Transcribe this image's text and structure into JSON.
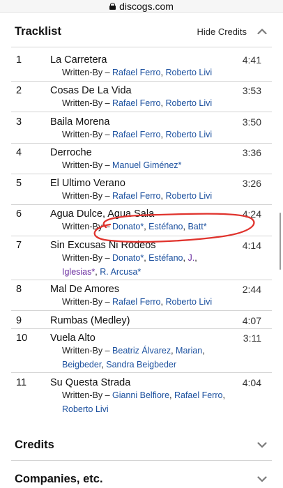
{
  "browser": {
    "domain": "discogs.com"
  },
  "tracklist": {
    "title": "Tracklist",
    "hide_credits_label": "Hide Credits",
    "tracks": [
      {
        "num": "1",
        "title": "La Carretera",
        "duration": "4:41",
        "role": "Written-By",
        "lines": [
          {
            "names": [
              "Rafael Ferro",
              "Roberto Livi"
            ]
          }
        ]
      },
      {
        "num": "2",
        "title": "Cosas De La Vida",
        "duration": "3:53",
        "role": "Written-By",
        "lines": [
          {
            "names": [
              "Rafael Ferro",
              "Roberto Livi"
            ]
          }
        ]
      },
      {
        "num": "3",
        "title": "Baila Morena",
        "duration": "3:50",
        "role": "Written-By",
        "lines": [
          {
            "names": [
              "Rafael Ferro",
              "Roberto Livi"
            ]
          }
        ]
      },
      {
        "num": "4",
        "title": "Derroche",
        "duration": "3:36",
        "role": "Written-By",
        "lines": [
          {
            "names": [
              "Manuel Giménez*"
            ]
          }
        ]
      },
      {
        "num": "5",
        "title": "El Ultimo Verano",
        "duration": "3:26",
        "role": "Written-By",
        "lines": [
          {
            "names": [
              "Rafael Ferro",
              "Roberto Livi"
            ]
          }
        ]
      },
      {
        "num": "6",
        "title": "Agua Dulce, Agua Sala",
        "duration": "4:24",
        "role": "Written-By",
        "lines": [
          {
            "names": [
              "Donato*",
              "Estéfano",
              "Batt*"
            ]
          }
        ]
      },
      {
        "num": "7",
        "title": "Sin Excusas Ni Rodeos",
        "duration": "4:14",
        "role": "Written-By",
        "lines": [
          {
            "names": [
              "Donato*",
              "Estéfano",
              "J."
            ]
          },
          {
            "names": [
              "Iglesias*",
              "R. Arcusa*"
            ]
          }
        ]
      },
      {
        "num": "8",
        "title": "Mal De Amores",
        "duration": "2:44",
        "role": "Written-By",
        "lines": [
          {
            "names": [
              "Rafael Ferro",
              "Roberto Livi"
            ]
          }
        ]
      },
      {
        "num": "9",
        "title": "Rumbas (Medley)",
        "duration": "4:07",
        "role": "",
        "lines": []
      },
      {
        "num": "10",
        "title": "Vuela Alto",
        "duration": "3:11",
        "role": "Written-By",
        "lines": [
          {
            "names": [
              "Beatriz Álvarez",
              "Marian"
            ]
          },
          {
            "names": [
              "Beigbeder",
              "Sandra Beigbeder"
            ]
          }
        ]
      },
      {
        "num": "11",
        "title": "Su Questa Strada",
        "duration": "4:04",
        "role": "Written-By",
        "lines": [
          {
            "names": [
              "Gianni Belfiore",
              "Rafael Ferro"
            ]
          },
          {
            "names": [
              "Roberto Livi"
            ]
          }
        ]
      }
    ]
  },
  "sections": {
    "credits_title": "Credits",
    "companies_title": "Companies, etc."
  },
  "colors": {
    "link": "#1a4f9e",
    "visited_link": "#6b2fa0",
    "annotation": "#e0332d"
  }
}
